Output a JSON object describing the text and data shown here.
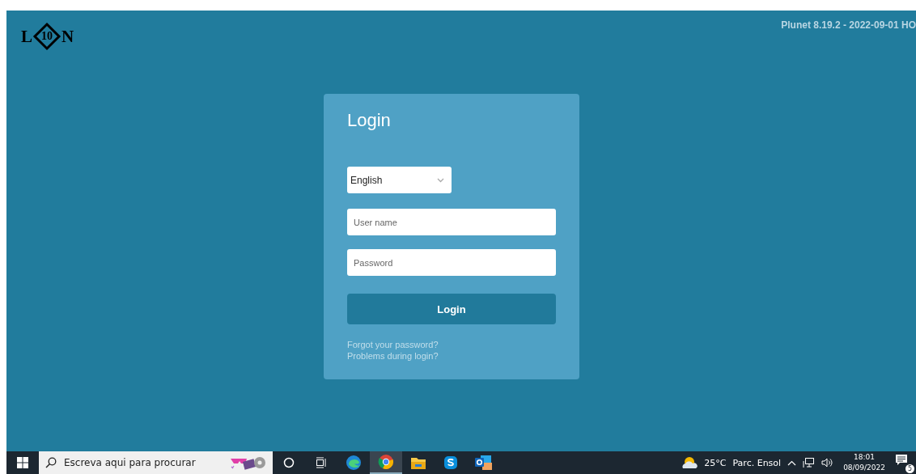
{
  "logo": {
    "left": "L",
    "middle": "10",
    "right": "N"
  },
  "version": "Plunet 8.19.2 - 2022-09-01 HO",
  "login": {
    "title": "Login",
    "language": "English",
    "username": {
      "placeholder": "User name"
    },
    "password": {
      "placeholder": "Password"
    },
    "button": "Login",
    "links": [
      "Forgot your password?",
      "Problems during login?"
    ]
  },
  "taskbar": {
    "search": {
      "placeholder": "Escreva aqui para procurar"
    },
    "apps": [
      {
        "kind": "edge",
        "selected": false
      },
      {
        "kind": "chrome",
        "selected": true
      },
      {
        "kind": "files",
        "selected": false
      },
      {
        "kind": "skype",
        "selected": false
      },
      {
        "kind": "outlook",
        "selected": false
      }
    ],
    "weather": {
      "temp": "25°C",
      "condition": "Parc. Ensol"
    },
    "time": "18:01",
    "date": "08/09/2022",
    "notifications": "5"
  }
}
